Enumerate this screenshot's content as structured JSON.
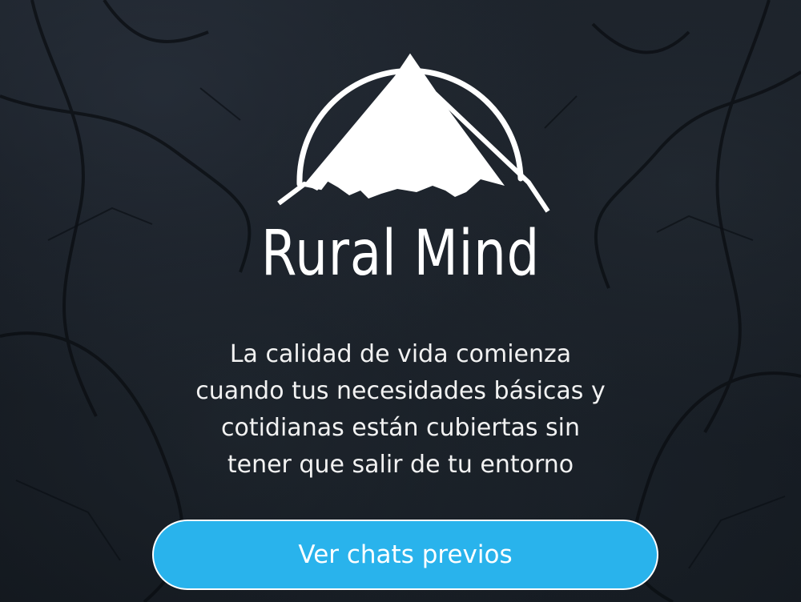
{
  "brand": {
    "name": "Rural Mind",
    "logo_icon": "mountain-in-circle-logo"
  },
  "tagline": {
    "lines": [
      "La calidad de vida comienza",
      "cuando tus necesidades básicas y",
      "cotidianas están cubiertas sin",
      "tener que salir de tu entorno"
    ]
  },
  "cta": {
    "label": "Ver chats previos",
    "color": "#29b3ec"
  },
  "colors": {
    "background": "#151a21",
    "text": "#ffffff"
  }
}
